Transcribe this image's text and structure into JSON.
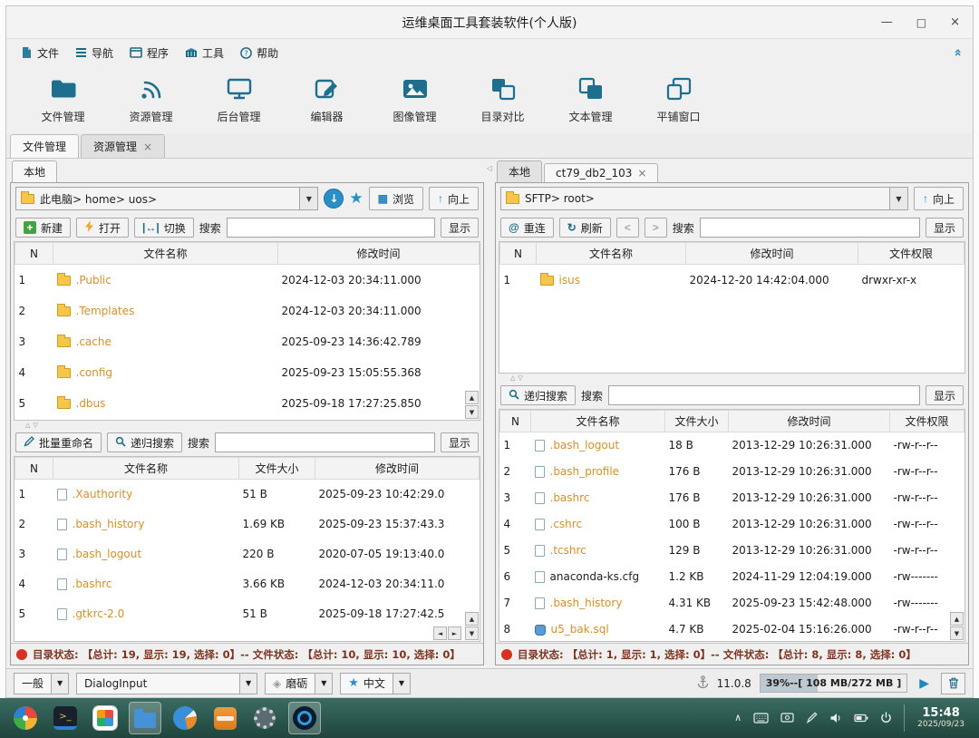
{
  "titlebar": {
    "title": "运维桌面工具套装软件(个人版)"
  },
  "glyphs": {
    "minimize": "—",
    "maximize": "□",
    "close": "×",
    "collapse_up": "«",
    "dropdown": "▼",
    "up_arrow": "↑",
    "down_arrow": "↓",
    "star": "★",
    "grid": "▦",
    "plus": "+",
    "switch": "|↔|",
    "at": "@",
    "refresh": "↻",
    "back": "<",
    "forward": ">",
    "scroll_up": "▲",
    "scroll_down": "▼",
    "scroll_left": "◄",
    "scroll_right": "►",
    "splitter_up": "△",
    "splitter_down": "▽",
    "splitter_left": "◁",
    "tray_expand": "∧",
    "play": "▶",
    "gem": "◈",
    "tab_close": "×"
  },
  "menubar": {
    "items": [
      {
        "label": "文件"
      },
      {
        "label": "导航"
      },
      {
        "label": "程序"
      },
      {
        "label": "工具"
      },
      {
        "label": "帮助"
      }
    ]
  },
  "toolbar": {
    "items": [
      {
        "label": "文件管理"
      },
      {
        "label": "资源管理"
      },
      {
        "label": "后台管理"
      },
      {
        "label": "编辑器"
      },
      {
        "label": "图像管理"
      },
      {
        "label": "目录对比"
      },
      {
        "label": "文本管理"
      },
      {
        "label": "平铺窗口"
      }
    ]
  },
  "main_tabs": {
    "file_mgmt": "文件管理",
    "resource_mgmt": "资源管理"
  },
  "left_panel": {
    "tab_local": "本地",
    "path": "此电脑> home> uos>",
    "browse": "浏览",
    "up": "向上",
    "new": "新建",
    "open": "打开",
    "switch": "切换",
    "search_label": "搜索",
    "show": "显示",
    "dir_table": {
      "headers": {
        "n": "N",
        "name": "文件名称",
        "mtime": "修改时间"
      },
      "rows": [
        {
          "n": "1",
          "name": ".Public",
          "mtime": "2024-12-03 20:34:11.000",
          "icon": "folder"
        },
        {
          "n": "2",
          "name": ".Templates",
          "mtime": "2024-12-03 20:34:11.000",
          "icon": "folder"
        },
        {
          "n": "3",
          "name": ".cache",
          "mtime": "2025-09-23 14:36:42.789",
          "icon": "folder"
        },
        {
          "n": "4",
          "name": ".config",
          "mtime": "2025-09-23 15:05:55.368",
          "icon": "folder"
        },
        {
          "n": "5",
          "name": ".dbus",
          "mtime": "2025-09-18 17:27:25.850",
          "icon": "folder"
        }
      ]
    },
    "batch_rename": "批量重命名",
    "recursive_search": "递归搜索",
    "search_label2": "搜索",
    "show2": "显示",
    "file_table": {
      "headers": {
        "n": "N",
        "name": "文件名称",
        "size": "文件大小",
        "mtime": "修改时间"
      },
      "rows": [
        {
          "n": "1",
          "name": ".Xauthority",
          "size": "51 B",
          "mtime": "2025-09-23 10:42:29.0",
          "icon": "file"
        },
        {
          "n": "2",
          "name": ".bash_history",
          "size": "1.69 KB",
          "mtime": "2025-09-23 15:37:43.3",
          "icon": "file"
        },
        {
          "n": "3",
          "name": ".bash_logout",
          "size": "220 B",
          "mtime": "2020-07-05 19:13:40.0",
          "icon": "file"
        },
        {
          "n": "4",
          "name": ".bashrc",
          "size": "3.66 KB",
          "mtime": "2024-12-03 20:34:11.0",
          "icon": "file"
        },
        {
          "n": "5",
          "name": ".gtkrc-2.0",
          "size": "51 B",
          "mtime": "2025-09-18 17:27:42.5",
          "icon": "file"
        }
      ]
    },
    "status": "目录状态: 【总计: 19, 显示: 19, 选择: 0】-- 文件状态: 【总计: 10, 显示: 10, 选择: 0】"
  },
  "right_panel": {
    "tab_local": "本地",
    "tab_session": "ct79_db2_103",
    "path": "SFTP> root>",
    "up": "向上",
    "reconnect": "重连",
    "refresh": "刷新",
    "search_label": "搜索",
    "show": "显示",
    "dir_table": {
      "headers": {
        "n": "N",
        "name": "文件名称",
        "mtime": "修改时间",
        "perm": "文件权限"
      },
      "rows": [
        {
          "n": "1",
          "name": "isus",
          "mtime": "2024-12-20 14:42:04.000",
          "perm": "drwxr-xr-x",
          "icon": "folder"
        }
      ]
    },
    "recursive_search": "递归搜索",
    "search_label2": "搜索",
    "show2": "显示",
    "file_table": {
      "headers": {
        "n": "N",
        "name": "文件名称",
        "size": "文件大小",
        "mtime": "修改时间",
        "perm": "文件权限"
      },
      "rows": [
        {
          "n": "1",
          "name": ".bash_logout",
          "size": "18 B",
          "mtime": "2013-12-29 10:26:31.000",
          "perm": "-rw-r--r--",
          "icon": "file"
        },
        {
          "n": "2",
          "name": ".bash_profile",
          "size": "176 B",
          "mtime": "2013-12-29 10:26:31.000",
          "perm": "-rw-r--r--",
          "icon": "file"
        },
        {
          "n": "3",
          "name": ".bashrc",
          "size": "176 B",
          "mtime": "2013-12-29 10:26:31.000",
          "perm": "-rw-r--r--",
          "icon": "file"
        },
        {
          "n": "4",
          "name": ".cshrc",
          "size": "100 B",
          "mtime": "2013-12-29 10:26:31.000",
          "perm": "-rw-r--r--",
          "icon": "file"
        },
        {
          "n": "5",
          "name": ".tcshrc",
          "size": "129 B",
          "mtime": "2013-12-29 10:26:31.000",
          "perm": "-rw-r--r--",
          "icon": "file"
        },
        {
          "n": "6",
          "name": "anaconda-ks.cfg",
          "size": "1.2 KB",
          "mtime": "2024-11-29 12:04:19.000",
          "perm": "-rw-------",
          "icon": "file",
          "plain": true
        },
        {
          "n": "7",
          "name": ".bash_history",
          "size": "4.31 KB",
          "mtime": "2025-09-23 15:42:48.000",
          "perm": "-rw-------",
          "icon": "file"
        },
        {
          "n": "8",
          "name": "u5_bak.sql",
          "size": "4.7 KB",
          "mtime": "2025-02-04 15:16:26.000",
          "perm": "-rw-r--r--",
          "icon": "db"
        }
      ]
    },
    "status": "目录状态: 【总计: 1, 显示: 1, 选择: 0】-- 文件状态: 【总计: 8, 显示: 8, 选择: 0】"
  },
  "bottom_bar": {
    "style_select": "一般",
    "font_select": "DialogInput",
    "theme_select": "磨砺",
    "lang_select": "中文",
    "version": "11.0.8",
    "memory": "39%--[ 108 MB/272 MB ]"
  },
  "taskbar": {
    "clock_time": "15:48",
    "clock_date": "2025/09/23"
  }
}
